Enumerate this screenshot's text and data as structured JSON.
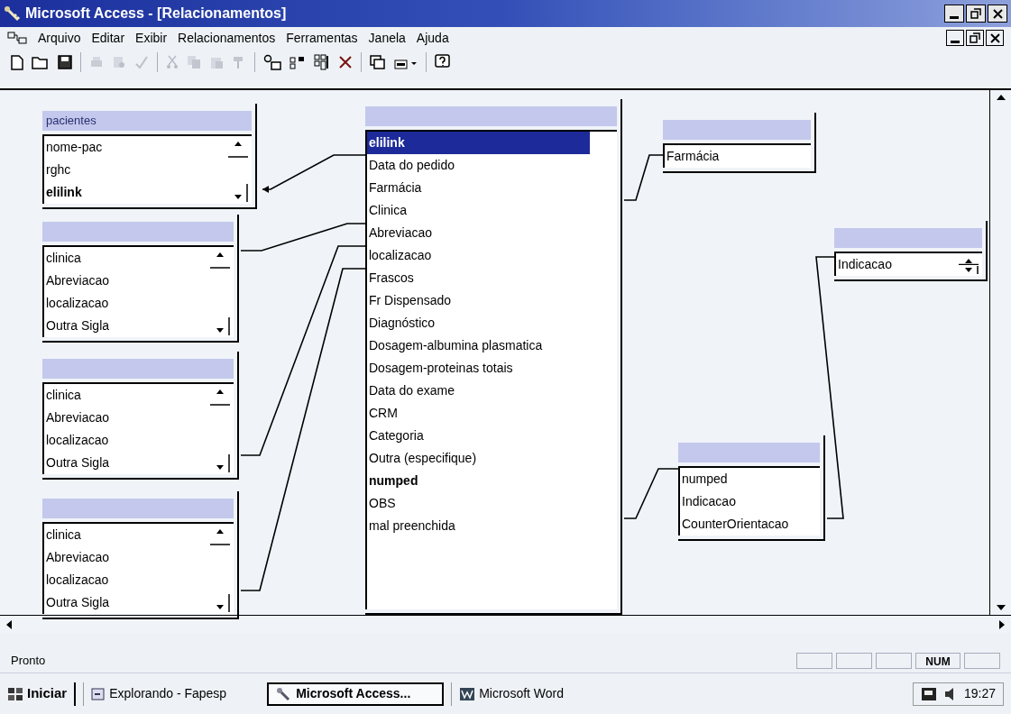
{
  "window": {
    "title": "Microsoft Access - [Relacionamentos]"
  },
  "menu": [
    "Arquivo",
    "Editar",
    "Exibir",
    "Relacionamentos",
    "Ferramentas",
    "Janela",
    "Ajuda"
  ],
  "tables": [
    {
      "title": "pacientes",
      "kind": "scrolled",
      "fields": [
        {
          "name": "nome-pac",
          "key": false,
          "selected": false
        },
        {
          "name": "rghc",
          "key": false,
          "selected": false
        },
        {
          "name": "elilink",
          "key": true,
          "selected": false
        }
      ]
    },
    {
      "kind": "scrolled",
      "fields": [
        {
          "name": "clinica",
          "key": false,
          "selected": false
        },
        {
          "name": "Abreviacao",
          "key": false,
          "selected": false
        },
        {
          "name": "localizacao",
          "key": false,
          "selected": false
        },
        {
          "name": "Outra Sigla",
          "key": false,
          "selected": false
        }
      ]
    },
    {
      "kind": "scrolled",
      "fields": [
        {
          "name": "clinica",
          "key": false,
          "selected": false
        },
        {
          "name": "Abreviacao",
          "key": false,
          "selected": false
        },
        {
          "name": "localizacao",
          "key": false,
          "selected": false
        },
        {
          "name": "Outra Sigla",
          "key": false,
          "selected": false
        }
      ]
    },
    {
      "kind": "scrolled",
      "fields": [
        {
          "name": "clinica",
          "key": false,
          "selected": false
        },
        {
          "name": "Abreviacao",
          "key": false,
          "selected": false
        },
        {
          "name": "localizacao",
          "key": false,
          "selected": false
        },
        {
          "name": "Outra Sigla",
          "key": false,
          "selected": false
        }
      ]
    },
    {
      "kind": "plain",
      "fields": [
        {
          "name": "elilink",
          "key": false,
          "selected": true
        },
        {
          "name": "Data do pedido",
          "key": false,
          "selected": false
        },
        {
          "name": "Farmácia",
          "key": false,
          "selected": false
        },
        {
          "name": "Clinica",
          "key": false,
          "selected": false
        },
        {
          "name": "Abreviacao",
          "key": false,
          "selected": false
        },
        {
          "name": "localizacao",
          "key": false,
          "selected": false
        },
        {
          "name": "Frascos",
          "key": false,
          "selected": false
        },
        {
          "name": "Fr Dispensado",
          "key": false,
          "selected": false
        },
        {
          "name": "Diagnóstico",
          "key": false,
          "selected": false
        },
        {
          "name": "Dosagem-albumina plasmatica",
          "key": false,
          "selected": false
        },
        {
          "name": "Dosagem-proteinas totais",
          "key": false,
          "selected": false
        },
        {
          "name": "Data do exame",
          "key": false,
          "selected": false
        },
        {
          "name": "CRM",
          "key": false,
          "selected": false
        },
        {
          "name": "Categoria",
          "key": false,
          "selected": false
        },
        {
          "name": "Outra (especifique)",
          "key": false,
          "selected": false
        },
        {
          "name": "numped",
          "key": true,
          "selected": false
        },
        {
          "name": "OBS",
          "key": false,
          "selected": false
        },
        {
          "name": "mal preenchida",
          "key": false,
          "selected": false
        }
      ]
    },
    {
      "kind": "plain",
      "fields": [
        {
          "name": "Farmácia",
          "key": false,
          "selected": false
        }
      ]
    },
    {
      "kind": "spin",
      "fields": [
        {
          "name": "Indicacao",
          "key": false,
          "selected": false
        }
      ]
    },
    {
      "kind": "plain",
      "fields": [
        {
          "name": "numped",
          "key": false,
          "selected": false
        },
        {
          "name": "Indicacao",
          "key": false,
          "selected": false
        },
        {
          "name": "CounterOrientacao",
          "key": false,
          "selected": false
        }
      ]
    }
  ],
  "status_bar": {
    "text": "Pronto",
    "indicator": "NUM"
  },
  "taskbar": {
    "start": "Iniciar",
    "items": [
      {
        "label": "Explorando - Fapesp",
        "selected": false
      },
      {
        "label": "Microsoft Access...",
        "selected": true
      },
      {
        "label": "Microsoft Word",
        "selected": false
      }
    ],
    "clock": "19:27"
  }
}
